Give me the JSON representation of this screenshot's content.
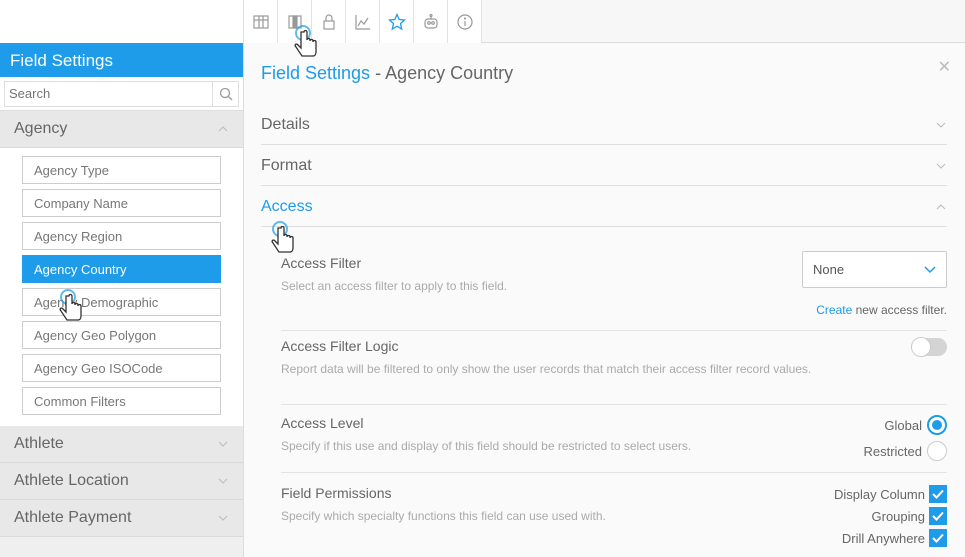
{
  "toolbar": {
    "icons": [
      "table-icon",
      "column-icon",
      "lock-icon",
      "chart-icon",
      "star-icon",
      "robot-icon",
      "info-icon"
    ]
  },
  "sidebar": {
    "title": "Field Settings",
    "search_placeholder": "Search",
    "groups": [
      {
        "label": "Agency",
        "expanded": true
      },
      {
        "label": "Athlete",
        "expanded": false
      },
      {
        "label": "Athlete Location",
        "expanded": false
      },
      {
        "label": "Athlete Payment",
        "expanded": false
      }
    ],
    "items": [
      "Agency Type",
      "Company Name",
      "Agency Region",
      "Agency Country",
      "Agency Demographic",
      "Agency Geo Polygon",
      "Agency Geo ISOCode",
      "Common Filters"
    ],
    "selected_item": "Agency Country"
  },
  "main": {
    "title_link": "Field Settings",
    "title_rest": " - Agency Country",
    "sections": [
      {
        "label": "Details"
      },
      {
        "label": "Format"
      },
      {
        "label": "Access"
      }
    ],
    "access_filter": {
      "title": "Access Filter",
      "desc": "Select an access filter to apply to this field.",
      "selected": "None",
      "create_link": "Create",
      "create_rest": " new access filter."
    },
    "access_filter_logic": {
      "title": "Access Filter Logic",
      "desc": "Report data will be filtered to only show the user records that match their access filter record values.",
      "enabled": false
    },
    "access_level": {
      "title": "Access Level",
      "desc": "Specify if this use and display of this field should be restricted to select users.",
      "options": [
        "Global",
        "Restricted"
      ],
      "selected": "Global"
    },
    "field_permissions": {
      "title": "Field Permissions",
      "desc": "Specify which specialty functions this field can use used with.",
      "options": [
        "Display Column",
        "Grouping",
        "Drill Anywhere"
      ],
      "checked": [
        true,
        true,
        true
      ]
    }
  },
  "colors": {
    "accent": "#1e9be9"
  }
}
